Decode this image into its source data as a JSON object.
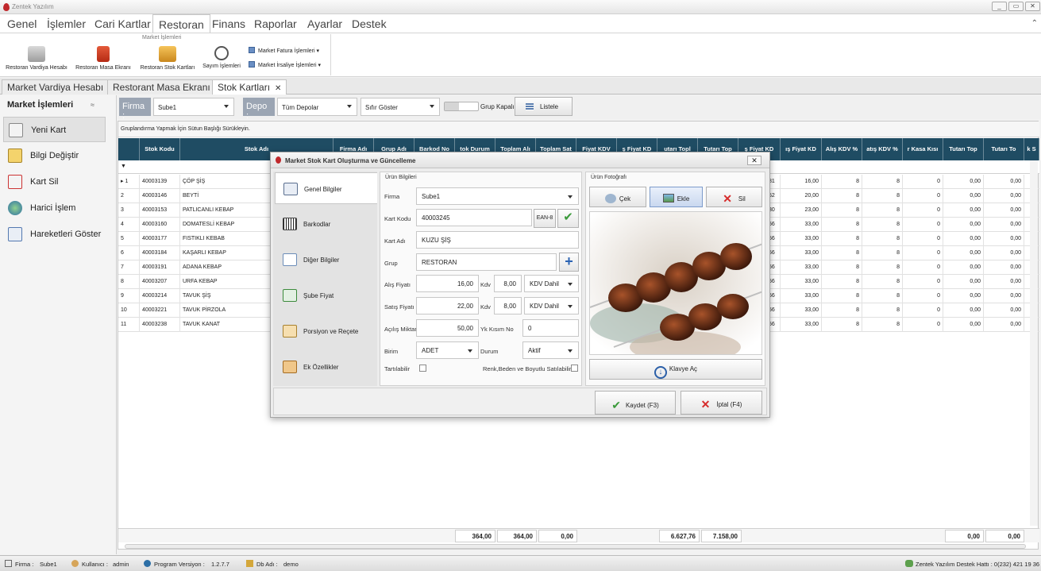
{
  "window": {
    "title": "Zentek Yazılım",
    "controls": [
      "_",
      "▭",
      "✕"
    ]
  },
  "menu": [
    "Genel",
    "İşlemler",
    "Cari Kartlar",
    "Restoran",
    "Finans",
    "Raporlar",
    "Ayarlar",
    "Destek"
  ],
  "ribbon": {
    "group_label": "Market İşlemleri",
    "buttons": [
      "Restoran Vardiya Hesabı",
      "Restoran Masa Ekranı",
      "Restoran Stok Kartları",
      "Sayım İşlemleri"
    ],
    "small": [
      "Market Fatura İşlemleri",
      "Market İrsaliye İşlemleri"
    ]
  },
  "tabs": [
    "Market Vardiya Hesabı",
    "Restorant Masa Ekranı",
    "Stok Kartları"
  ],
  "sidebar": {
    "title": "Market İşlemleri",
    "collapse": "≈",
    "items": [
      "Yeni Kart",
      "Bilgi Değiştir",
      "Kart Sil",
      "Harici İşlem",
      "Hareketleri Göster"
    ]
  },
  "filters": {
    "firma_label": "Firma :",
    "firma_value": "Sube1",
    "depo_label": "Depo :",
    "depo_value": "Tüm Depolar",
    "sifir": "Sıfır Göster",
    "grup_kapali": "Grup Kapalı",
    "listele": "Listele"
  },
  "grid": {
    "group_hint": "Gruplandırma Yapmak İçin Sütun Başlığı Sürükleyin.",
    "headers": [
      "Stok Kodu",
      "Stok Adı",
      "Firma Adı",
      "Grup Adı",
      "Barkod No",
      "tok Durum",
      "Toplam Alı",
      "Toplam Sat",
      "Fiyat KDV",
      "ş Fiyat KD",
      "utarı Topl",
      "Tutarı Top",
      "ş Fiyat KD",
      "ış Fiyat KD",
      "Alış KDV %",
      "atış KDV %",
      "r Kasa Kısı",
      "Tutarı Top",
      "Tutarı To",
      "k S"
    ],
    "rows": [
      {
        "n": "1",
        "code": "40003139",
        "name": "ÇÖP ŞİŞ",
        "p": "81",
        "price": "16,00",
        "kdv1": "8",
        "kdv2": "8",
        "kasa": "0",
        "t1": "0,00",
        "t2": "0,00"
      },
      {
        "n": "2",
        "code": "40003146",
        "name": "BEYTİ",
        "p": "52",
        "price": "20,00",
        "kdv1": "8",
        "kdv2": "8",
        "kasa": "0",
        "t1": "0,00",
        "t2": "0,00"
      },
      {
        "n": "3",
        "code": "40003153",
        "name": "PATLICANLI KEBAP",
        "p": "30",
        "price": "23,00",
        "kdv1": "8",
        "kdv2": "8",
        "kasa": "0",
        "t1": "0,00",
        "t2": "0,00"
      },
      {
        "n": "4",
        "code": "40003160",
        "name": "DOMATESLİ KEBAP",
        "p": "56",
        "price": "33,00",
        "kdv1": "8",
        "kdv2": "8",
        "kasa": "0",
        "t1": "0,00",
        "t2": "0,00"
      },
      {
        "n": "5",
        "code": "40003177",
        "name": "FISTIKLI KEBAB",
        "p": "56",
        "price": "33,00",
        "kdv1": "8",
        "kdv2": "8",
        "kasa": "0",
        "t1": "0,00",
        "t2": "0,00"
      },
      {
        "n": "6",
        "code": "40003184",
        "name": "KAŞARLI KEBAP",
        "p": "56",
        "price": "33,00",
        "kdv1": "8",
        "kdv2": "8",
        "kasa": "0",
        "t1": "0,00",
        "t2": "0,00"
      },
      {
        "n": "7",
        "code": "40003191",
        "name": "ADANA KEBAP",
        "p": "56",
        "price": "33,00",
        "kdv1": "8",
        "kdv2": "8",
        "kasa": "0",
        "t1": "0,00",
        "t2": "0,00"
      },
      {
        "n": "8",
        "code": "40003207",
        "name": "URFA KEBAP",
        "p": "56",
        "price": "33,00",
        "kdv1": "8",
        "kdv2": "8",
        "kasa": "0",
        "t1": "0,00",
        "t2": "0,00"
      },
      {
        "n": "9",
        "code": "40003214",
        "name": "TAVUK ŞİŞ",
        "p": "56",
        "price": "33,00",
        "kdv1": "8",
        "kdv2": "8",
        "kasa": "0",
        "t1": "0,00",
        "t2": "0,00"
      },
      {
        "n": "10",
        "code": "40003221",
        "name": "TAVUK PİRZOLA",
        "p": "56",
        "price": "33,00",
        "kdv1": "8",
        "kdv2": "8",
        "kasa": "0",
        "t1": "0,00",
        "t2": "0,00"
      },
      {
        "n": "11",
        "code": "40003238",
        "name": "TAVUK KANAT",
        "p": "56",
        "price": "33,00",
        "kdv1": "8",
        "kdv2": "8",
        "kasa": "0",
        "t1": "0,00",
        "t2": "0,00"
      }
    ],
    "totals": [
      "364,00",
      "364,00",
      "0,00",
      "6.627,76",
      "7.158,00",
      "0,00",
      "0,00"
    ]
  },
  "dialog": {
    "title": "Market Stok Kart Oluşturma ve Güncelleme",
    "nav": [
      "Genel Bilgiler",
      "Barkodlar",
      "Diğer Bilgiler",
      "Şube Fiyat",
      "Porsiyon ve Reçete",
      "Ek Özellikler"
    ],
    "info_title": "Ürün Bilgileri",
    "photo_title": "Ürün Fotoğrafı",
    "fields": {
      "firma_l": "Firma",
      "firma": "Sube1",
      "kod_l": "Kart Kodu",
      "kod": "40003245",
      "ean": "EAN-8",
      "ad_l": "Kart Adı",
      "ad": "KUZU ŞİŞ",
      "grup_l": "Grup",
      "grup": "RESTORAN",
      "alis_l": "Alış Fiyatı",
      "alis": "16,00",
      "kdv_l": "Kdv",
      "alis_kdv": "8,00",
      "kdv_dahil": "KDV Dahil",
      "satis_l": "Satış Fiyatı",
      "satis": "22,00",
      "satis_kdv": "8,00",
      "acilis_l": "Açılış Miktar",
      "acilis": "50,00",
      "yk_l": "Yk Kısım No",
      "yk": "0",
      "birim_l": "Birim",
      "birim": "ADET",
      "durum_l": "Durum",
      "durum": "Aktif",
      "tartilabilir": "Tartılabilir",
      "renk": "Renk,Beden ve Boyutlu Satılabilir"
    },
    "photo_buttons": [
      "Çek",
      "Ekle",
      "Sil"
    ],
    "klavye": "Klavye Aç",
    "kaydet": "Kaydet (F3)",
    "iptal": "İptal (F4)"
  },
  "status": {
    "firma_l": "Firma :",
    "firma": "Sube1",
    "kul_l": "Kullanıcı :",
    "kul": "admin",
    "ver_l": "Program Versiyon :",
    "ver": "1.2.7.7",
    "db_l": "Db Adı :",
    "db": "demo",
    "destek": "Zentek Yazılım Destek Hattı : 0(232) 421 19 36"
  },
  "colors": {
    "header": "#1f4c63",
    "accent_red": "#c0282c",
    "label_bg": "#9ba5b3"
  }
}
